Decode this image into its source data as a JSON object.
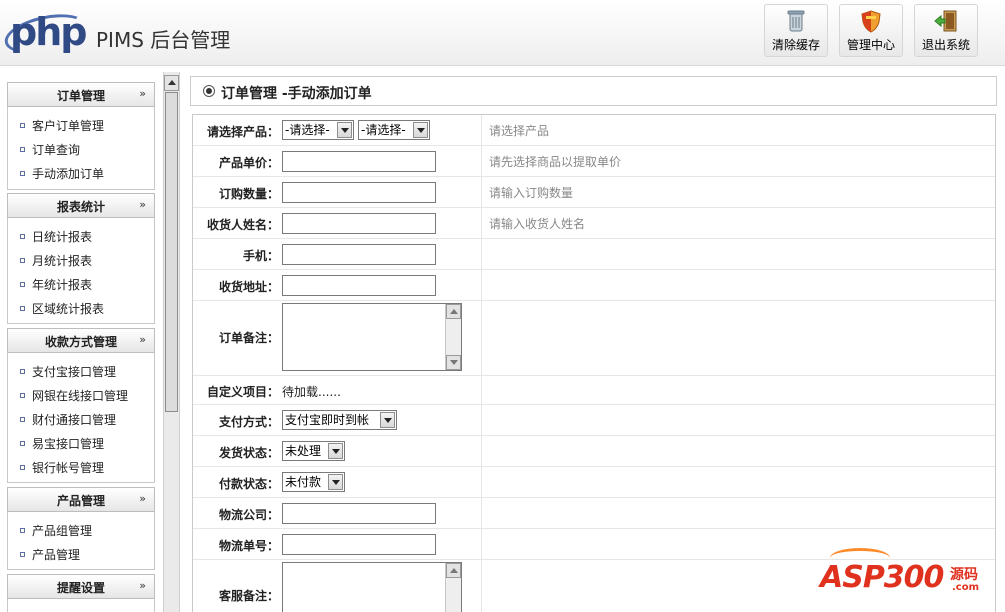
{
  "header": {
    "logo_text": "php",
    "app_title": "PIMS 后台管理",
    "buttons": [
      {
        "label": "清除缓存",
        "icon": "trash-bin-icon"
      },
      {
        "label": "管理中心",
        "icon": "shield-icon"
      },
      {
        "label": "退出系统",
        "icon": "exit-door-icon"
      }
    ]
  },
  "sidebar": {
    "sections": [
      {
        "title": "订单管理",
        "items": [
          "客户订单管理",
          "订单查询",
          "手动添加订单"
        ]
      },
      {
        "title": "报表统计",
        "items": [
          "日统计报表",
          "月统计报表",
          "年统计报表",
          "区域统计报表"
        ]
      },
      {
        "title": "收款方式管理",
        "items": [
          "支付宝接口管理",
          "网银在线接口管理",
          "财付通接口管理",
          "易宝接口管理",
          "银行帐号管理"
        ]
      },
      {
        "title": "产品管理",
        "items": [
          "产品组管理",
          "产品管理"
        ]
      },
      {
        "title": "提醒设置",
        "items": []
      }
    ],
    "collapse_glyph": "»"
  },
  "main": {
    "title": "订单管理 -手动添加订单",
    "form": {
      "product": {
        "label": "请选择产品：",
        "select1": "-请选择-",
        "select2": "-请选择-",
        "hint": "请选择产品"
      },
      "unit_price": {
        "label": "产品单价：",
        "value": "",
        "hint": "请先选择商品以提取单价"
      },
      "quantity": {
        "label": "订购数量：",
        "value": "",
        "hint": "请输入订购数量"
      },
      "receiver_name": {
        "label": "收货人姓名：",
        "value": "",
        "hint": "请输入收货人姓名"
      },
      "mobile": {
        "label": "手机：",
        "value": ""
      },
      "address": {
        "label": "收货地址：",
        "value": ""
      },
      "order_note": {
        "label": "订单备注：",
        "value": ""
      },
      "custom_items": {
        "label": "自定义项目：",
        "value": "待加载......"
      },
      "payment_method": {
        "label": "支付方式：",
        "value": "支付宝即时到帐"
      },
      "shipping_status": {
        "label": "发货状态：",
        "value": "未处理"
      },
      "payment_status": {
        "label": "付款状态：",
        "value": "未付款"
      },
      "logistics_company": {
        "label": "物流公司：",
        "value": ""
      },
      "tracking_number": {
        "label": "物流单号：",
        "value": ""
      },
      "service_note": {
        "label": "客服备注：",
        "value": ""
      }
    }
  },
  "watermark": {
    "brand": "ASP300",
    "suffix": "源码",
    "domain": ".com"
  }
}
